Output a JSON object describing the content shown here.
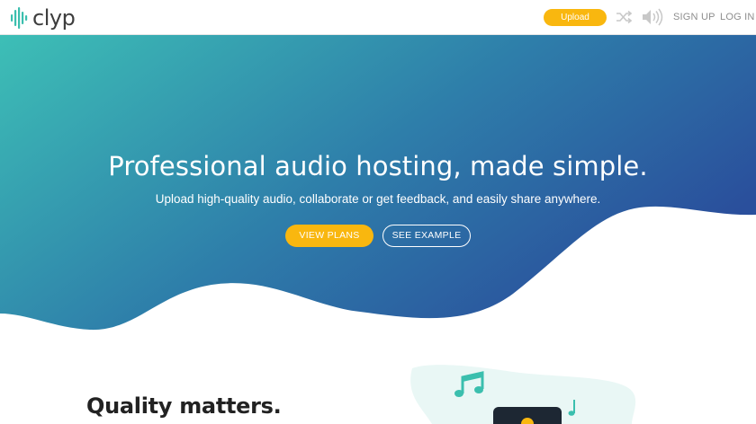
{
  "header": {
    "logo_text": "clyp",
    "upload_label": "Upload",
    "signup_label": "SIGN UP",
    "login_label": "LOG IN"
  },
  "hero": {
    "title": "Professional audio hosting, made simple.",
    "subtitle": "Upload high-quality audio, collaborate or get feedback, and easily share anywhere.",
    "view_plans_label": "VIEW PLANS",
    "see_example_label": "SEE EXAMPLE"
  },
  "section": {
    "heading": "Quality matters."
  },
  "colors": {
    "accent": "#f9b70f",
    "hero_start": "#3dbfb6",
    "hero_end": "#2a4f9c",
    "logo_teal": "#3bbfae"
  },
  "icons": {
    "shuffle": "shuffle-icon",
    "volume": "volume-icon",
    "logo": "waveform-icon",
    "music_note": "music-note-icon"
  }
}
